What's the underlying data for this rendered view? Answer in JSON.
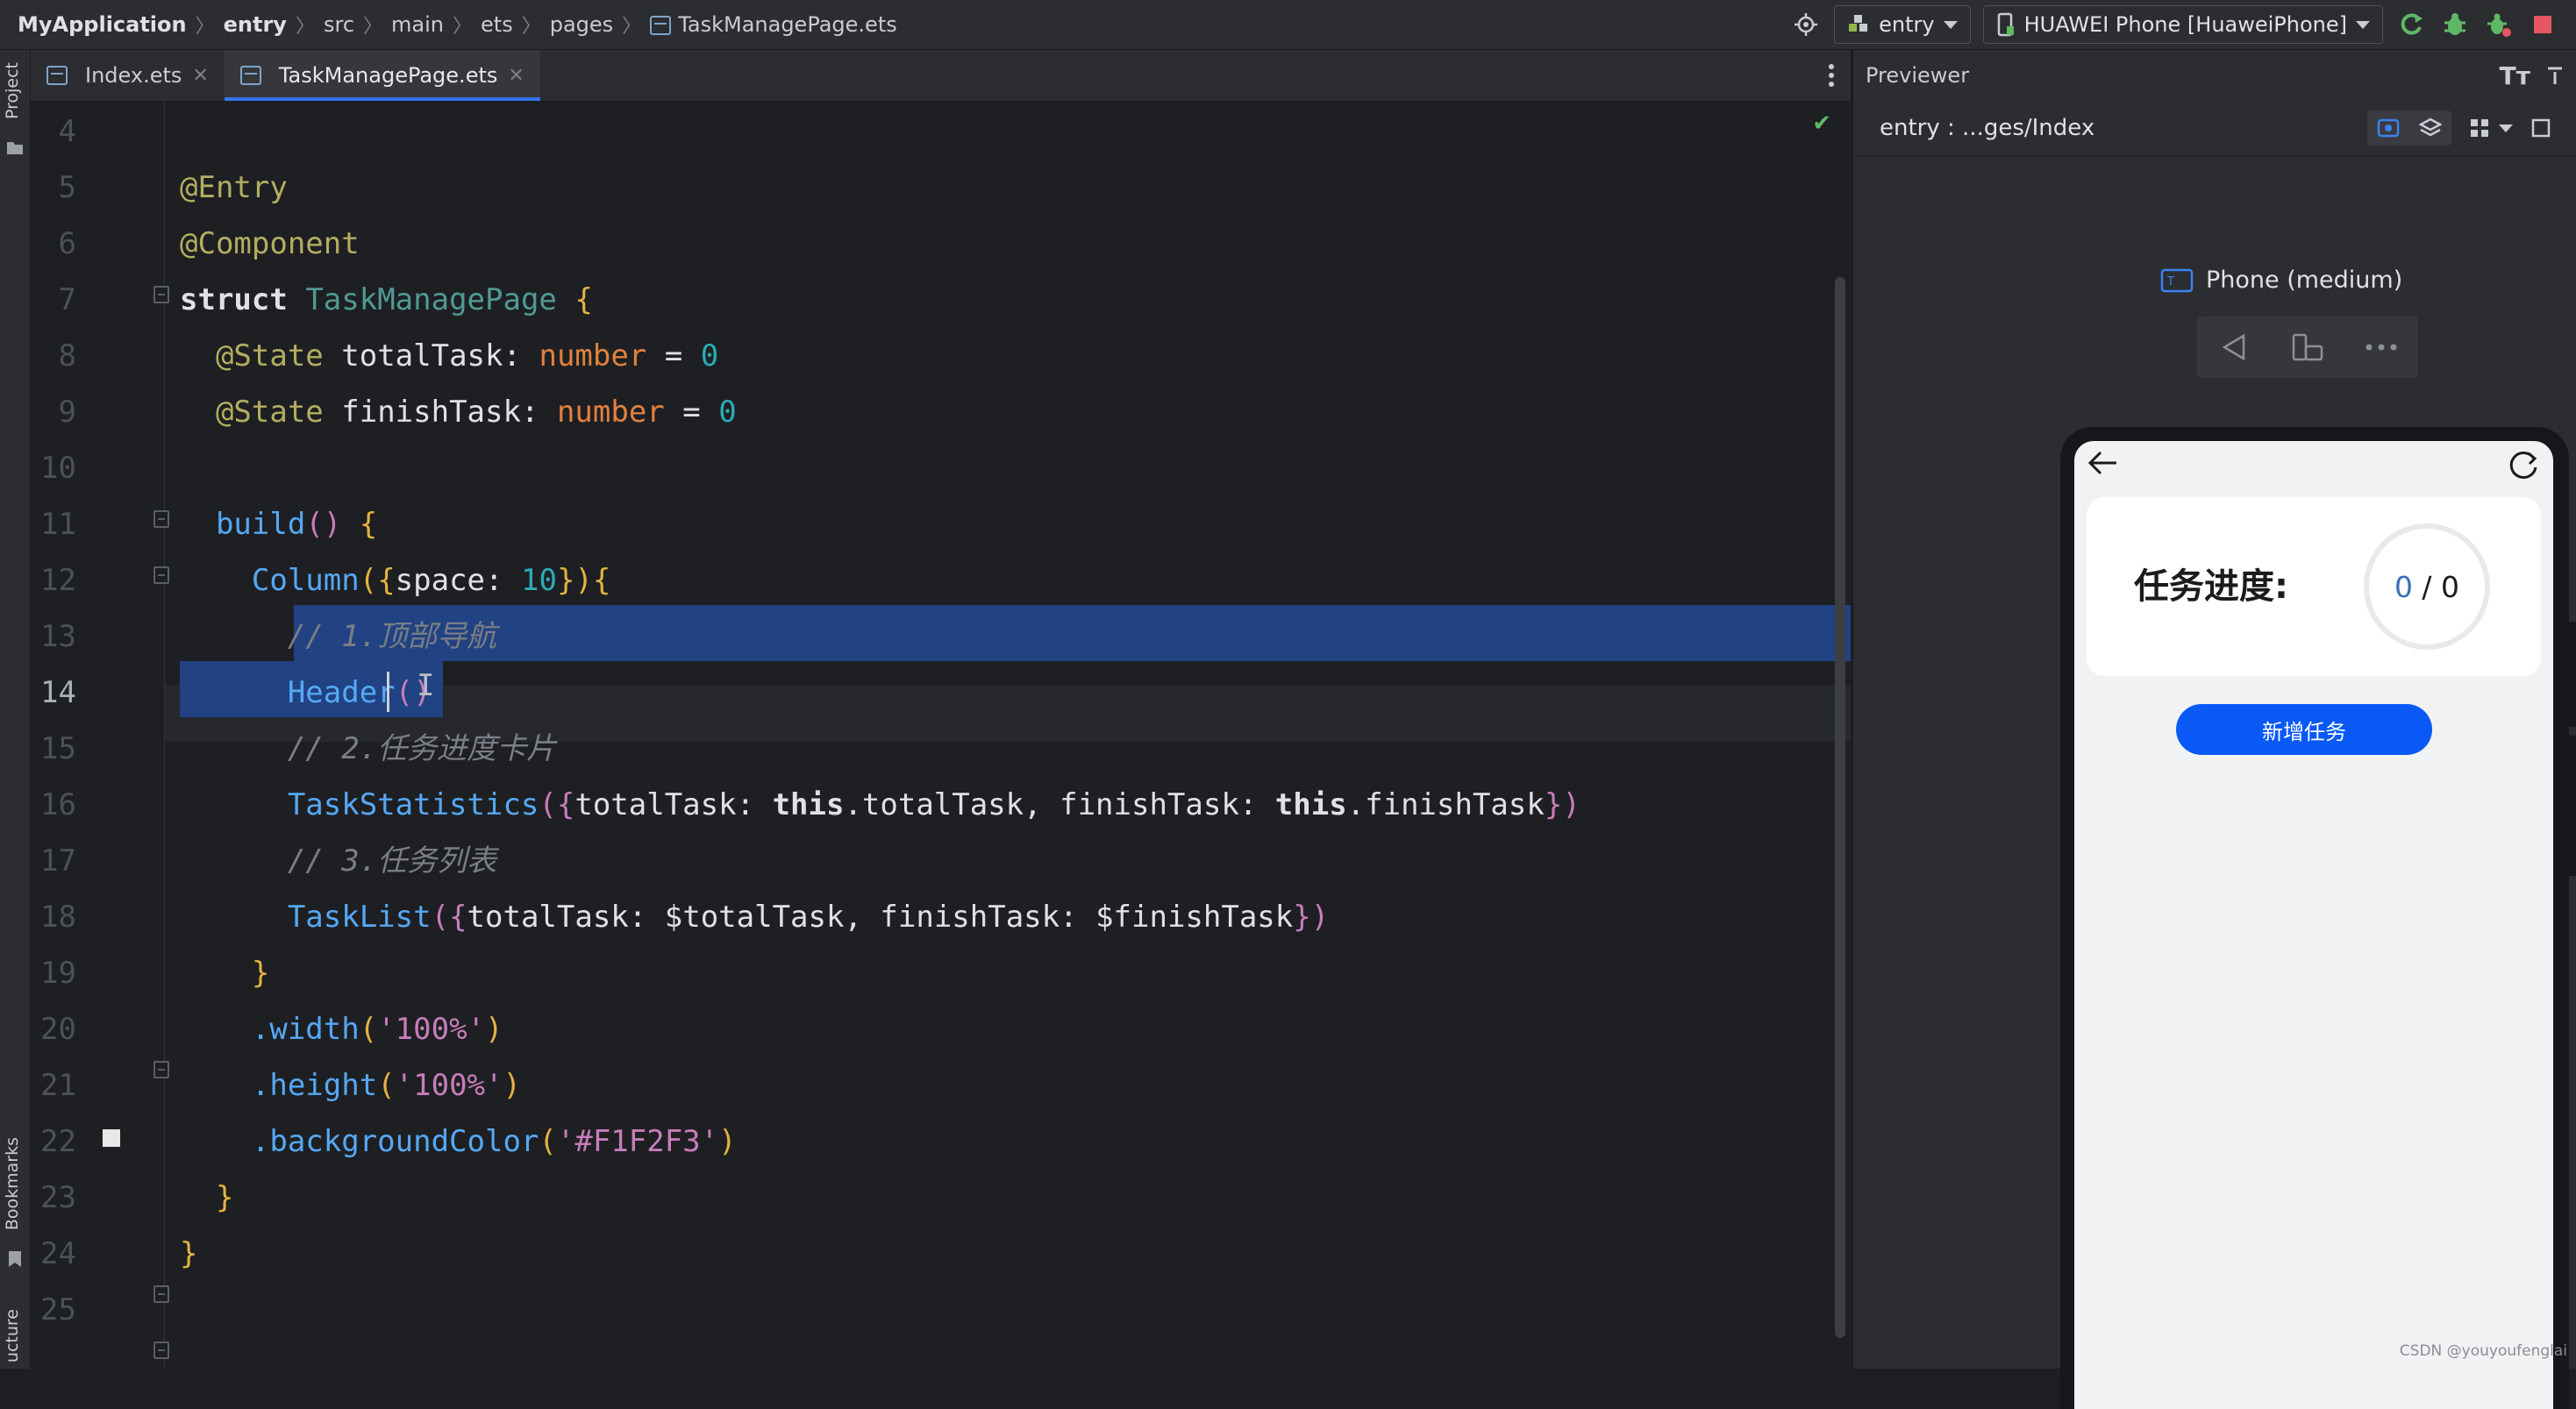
{
  "breadcrumb": {
    "project": "MyApplication",
    "items": [
      "entry",
      "src",
      "main",
      "ets",
      "pages"
    ],
    "file": "TaskManagePage.ets"
  },
  "toolbar": {
    "module_combo": "entry",
    "device_combo": "HUAWEI Phone [HuaweiPhone]",
    "icons": [
      "target-icon",
      "run-icon",
      "debug-icon",
      "attach-debugger-icon",
      "stop-icon"
    ],
    "colors": {
      "run": "#5fb865",
      "stop": "#e55765"
    }
  },
  "left_strip": {
    "project_label": "Project",
    "bookmarks_label": "Bookmarks",
    "structure_label": "ucture"
  },
  "tabs": [
    {
      "label": "Index.ets",
      "active": false
    },
    {
      "label": "TaskManagePage.ets",
      "active": true
    }
  ],
  "editor": {
    "current_line": "14",
    "line_numbers": [
      "4",
      "5",
      "6",
      "7",
      "8",
      "9",
      "10",
      "11",
      "12",
      "13",
      "14",
      "15",
      "16",
      "17",
      "18",
      "19",
      "20",
      "21",
      "22",
      "23",
      "24",
      "25"
    ],
    "lines": {
      "l5": "@Entry",
      "l6": "@Component",
      "l7_kw": "struct",
      "l7_name": "TaskManagePage",
      "l7_brace": "{",
      "l8_ann": "@State",
      "l8_var": "totalTask",
      "l8_colon": ":",
      "l8_type": "number",
      "l8_eq": "=",
      "l8_val": "0",
      "l9_ann": "@State",
      "l9_var": "finishTask",
      "l9_colon": ":",
      "l9_type": "number",
      "l9_eq": "=",
      "l9_val": "0",
      "l11_fn": "build",
      "l11_parens": "()",
      "l11_brace": "{",
      "l12_fn": "Column",
      "l12_open": "({",
      "l12_key": "space",
      "l12_colon": ":",
      "l12_val": "10",
      "l12_close": "}){",
      "l13": "// 1.顶部导航",
      "l14_fn": "Header",
      "l14_parens": "()",
      "l15": "// 2.任务进度卡片",
      "l16_fn": "TaskStatistics",
      "l16_open": "({",
      "l16_k1": "totalTask",
      "l16_c1": ":",
      "l16_this1": "this",
      "l16_p1": ".totalTask,",
      "l16_k2": "finishTask",
      "l16_c2": ":",
      "l16_this2": "this",
      "l16_p2": ".finishTask",
      "l16_close": "})",
      "l17": "// 3.任务列表",
      "l18_fn": "TaskList",
      "l18_open": "({",
      "l18_k1": "totalTask",
      "l18_c1": ":",
      "l18_v1": "$totalTask,",
      "l18_k2": "finishTask",
      "l18_c2": ":",
      "l18_v2": "$finishTask",
      "l18_close": "})",
      "l19": "}",
      "l20_m": ".width",
      "l20_open": "(",
      "l20_s": "'100%'",
      "l20_close": ")",
      "l21_m": ".height",
      "l21_open": "(",
      "l21_s": "'100%'",
      "l21_close": ")",
      "l22_m": ".backgroundColor",
      "l22_open": "(",
      "l22_s": "'#F1F2F3'",
      "l22_close": ")",
      "l23": "}",
      "l24": "}"
    }
  },
  "previewer": {
    "title": "Previewer",
    "path": "entry : ...ges/Index",
    "device_label": "Phone (medium)",
    "app": {
      "card_title": "任务进度:",
      "progress_finished": "0",
      "progress_sep": " / ",
      "progress_total": "0",
      "add_button": "新增任务",
      "bg_color": "#F1F2F3",
      "button_color": "#0A59F7"
    },
    "watermark": "CSDN @youyoufenglai"
  }
}
